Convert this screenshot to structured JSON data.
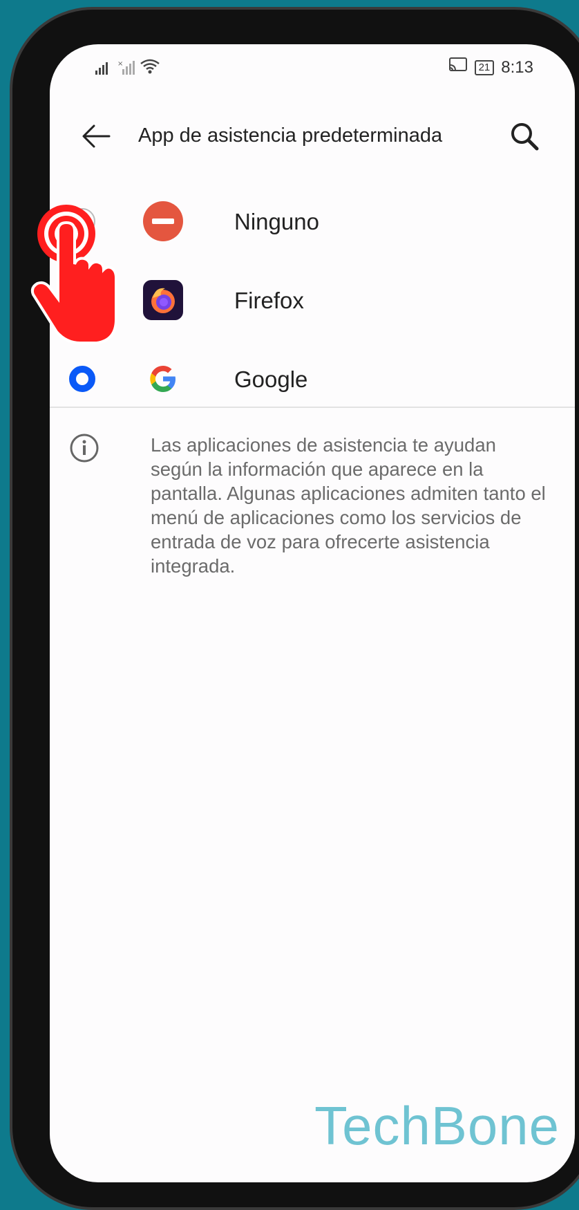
{
  "status_bar": {
    "time": "8:13",
    "battery": "21"
  },
  "header": {
    "title": "App de asistencia predeterminada"
  },
  "options": [
    {
      "label": "Ninguno",
      "icon": "no-entry-icon",
      "selected": false
    },
    {
      "label": "Firefox",
      "icon": "firefox-icon",
      "selected": false
    },
    {
      "label": "Google",
      "icon": "google-icon",
      "selected": true
    }
  ],
  "info": {
    "text": "Las aplicaciones de asistencia te ayudan según la información que aparece en la pantalla. Algunas aplicaciones admiten tanto el menú de aplicaciones como los servicios de entrada de voz para ofrecerte asistencia integrada."
  },
  "watermark": "TechBone",
  "colors": {
    "accent": "#0a59f7",
    "tap_indicator": "#ff1f1f",
    "background": "#0e7a8c"
  }
}
